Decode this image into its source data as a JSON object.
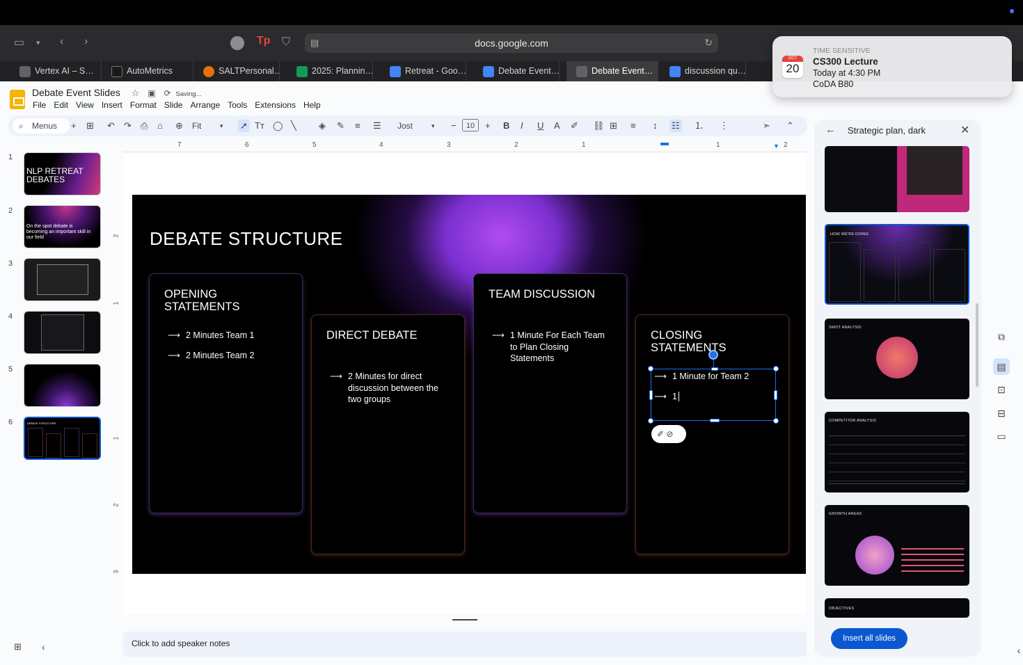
{
  "browser": {
    "url": "docs.google.com",
    "tabs": [
      {
        "label": "Vertex AI – S…",
        "color": "#5f6368"
      },
      {
        "label": "AutoMetrics",
        "color": "#1a1a1a"
      },
      {
        "label": "SALTPersonal…",
        "color": "#e8710a"
      },
      {
        "label": "2025: Plannin…",
        "color": "#0f9d58"
      },
      {
        "label": "Retreat - Goo…",
        "color": "#4285f4"
      },
      {
        "label": "Debate Event…",
        "color": "#4285f4"
      },
      {
        "label": "Debate Event…",
        "color": "#5f6368"
      },
      {
        "label": "discussion qu…",
        "color": "#4285f4"
      }
    ]
  },
  "notification": {
    "kind": "TIME SENSITIVE",
    "title": "CS300 Lecture",
    "time": "Today at 4:30 PM",
    "location": "CoDA B80",
    "cal_month": "OCT",
    "cal_day": "20"
  },
  "doc": {
    "title": "Debate Event Slides",
    "status": "Saving...",
    "menu": [
      "File",
      "Edit",
      "View",
      "Insert",
      "Format",
      "Slide",
      "Arrange",
      "Tools",
      "Extensions",
      "Help"
    ]
  },
  "toolbar": {
    "menus": "Menus",
    "zoom": "Fit",
    "font": "Jost",
    "font_size": "10"
  },
  "ruler": {
    "labels": [
      "7",
      "6",
      "5",
      "4",
      "3",
      "2",
      "1",
      "1",
      "2"
    ],
    "vlabels": [
      "2",
      "1",
      "1",
      "2",
      "3"
    ]
  },
  "filmstrip": [
    {
      "num": "1",
      "text": "NLP RETREAT DEBATES"
    },
    {
      "num": "2",
      "text": "On the spot debate is becoming an important skill in our field"
    },
    {
      "num": "3",
      "text": ""
    },
    {
      "num": "4",
      "text": ""
    },
    {
      "num": "5",
      "text": ""
    },
    {
      "num": "6",
      "text": "DEBATE STRUCTURE"
    }
  ],
  "slide": {
    "title": "DEBATE STRUCTURE",
    "cards": [
      {
        "title": "OPENING\nSTATEMENTS",
        "bullets": [
          "2 Minutes Team 1",
          "2 Minutes Team 2"
        ]
      },
      {
        "title": "DIRECT DEBATE",
        "bullets": [
          "2 Minutes for direct discussion between the two groups"
        ]
      },
      {
        "title": "TEAM DISCUSSION",
        "bullets": [
          "1 Minute For Each Team to Plan Closing Statements"
        ]
      },
      {
        "title": "CLOSING\nSTATEMENTS",
        "bullets": [
          "1 Minute for Team 2",
          "1"
        ]
      }
    ],
    "arrow": "⟶"
  },
  "speaker_notes": "Click to add speaker notes",
  "side_panel": {
    "title": "Strategic plan, dark",
    "templates": [
      "",
      "HOW WE'RE DOING",
      "SWOT ANALYSIS",
      "COMPETITOR ANALYSIS",
      "GROWTH AREAS",
      "OBJECTIVES"
    ],
    "insert_button": "Insert all slides"
  }
}
